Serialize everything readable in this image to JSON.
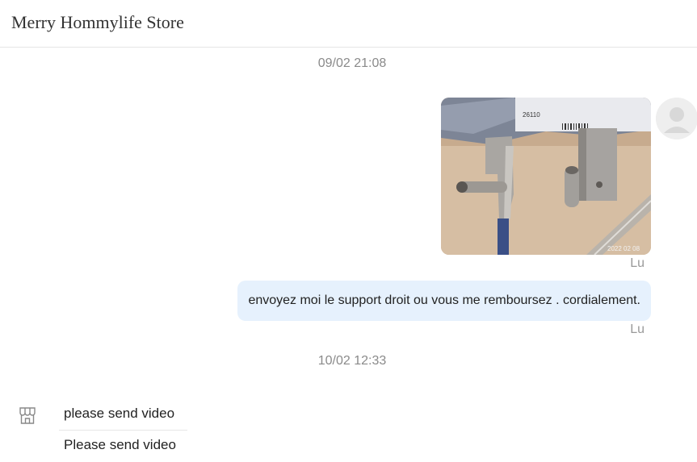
{
  "header": {
    "title": "Merry Hommylife Store"
  },
  "conversation": {
    "timestamps": [
      "09/02 21:08",
      "10/02 12:33"
    ],
    "outgoing": {
      "image_label_number": "26110",
      "image_date_stamp": "2022 02 08",
      "read_status_image": "Lu",
      "text_message": "envoyez moi le support droit ou vous me remboursez . cordialement.",
      "read_status_text": "Lu"
    },
    "incoming": {
      "messages": [
        "please send video",
        "Please send video"
      ]
    }
  },
  "icons": {
    "avatar": "user-avatar-icon",
    "store": "store-icon"
  },
  "colors": {
    "outgoing_bubble": "#e6f1fd",
    "timestamp": "#8a8a8a",
    "read_status": "#999999"
  }
}
